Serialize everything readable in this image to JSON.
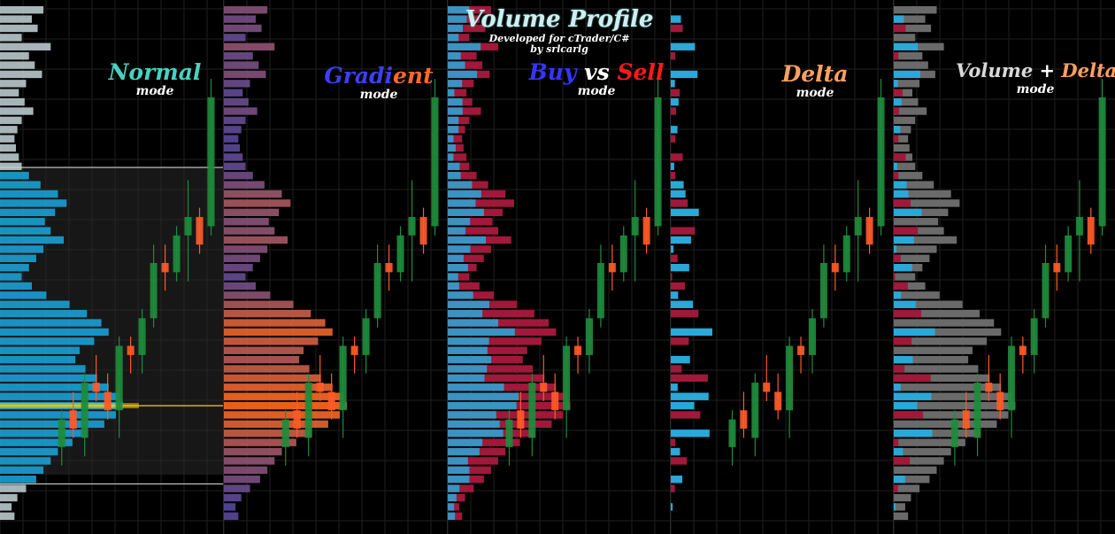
{
  "header": {
    "title": "Volume Profile",
    "subtitle": "Developed for cTrader/C#",
    "author": "by srlcarlg"
  },
  "panels": [
    {
      "id": "normal",
      "title_parts": [
        {
          "text": "Normal",
          "color": "#48d1c0"
        }
      ],
      "mode_label": "mode",
      "variant": "normal"
    },
    {
      "id": "gradient",
      "title_parts": [
        {
          "text": "Gradi",
          "color": "#3f3ff0"
        },
        {
          "text": "ent",
          "color": "#ff6a28"
        }
      ],
      "mode_label": "mode",
      "variant": "gradient"
    },
    {
      "id": "buysell",
      "title_parts": [
        {
          "text": "Buy",
          "color": "#3535ff"
        },
        {
          "text": " vs ",
          "color": "#ffffff"
        },
        {
          "text": "Sell",
          "color": "#ff1a1a"
        }
      ],
      "mode_label": "mode",
      "variant": "buysell"
    },
    {
      "id": "delta",
      "title_parts": [
        {
          "text": "Delta",
          "color": "#ffa060"
        }
      ],
      "mode_label": "mode",
      "variant": "delta"
    },
    {
      "id": "voldelta",
      "title_parts": [
        {
          "text": "Volume",
          "color": "#d8d8d8"
        },
        {
          "text": " + ",
          "color": "#ffffff"
        },
        {
          "text": "Delta",
          "color": "#ffa060"
        }
      ],
      "mode_label": "mode",
      "variant": "voldelta"
    }
  ],
  "colors": {
    "background": "#000000",
    "grid": "#1f1f1f",
    "bull_candle": "#1e8c3c",
    "bear_candle": "#ff5a28",
    "doji_candle": "#ff6a28",
    "volume_normal": "#1aa0d4",
    "volume_outside_va": "#b9c9cc",
    "value_area_fill": "#2a2a2a",
    "value_area_line": "#d0d0d0",
    "poc_line": "#ffd000",
    "buy": "#2aa8d8",
    "sell": "#a0183a",
    "delta_positive": "#2aa8d8",
    "delta_negative": "#a0183a",
    "total_volume": "#6a6a6a",
    "gradient_low": "#4444aa",
    "gradient_high": "#ff6a20"
  },
  "chart_data": {
    "type": "bar",
    "orientation": "horizontal",
    "price_levels_count": 56,
    "volume": [
      60,
      44,
      52,
      30,
      70,
      40,
      48,
      58,
      36,
      26,
      34,
      46,
      30,
      24,
      20,
      22,
      26,
      30,
      40,
      56,
      80,
      92,
      76,
      62,
      70,
      88,
      60,
      50,
      40,
      30,
      44,
      64,
      96,
      120,
      140,
      150,
      130,
      110,
      104,
      118,
      134,
      150,
      164,
      170,
      160,
      144,
      120,
      100,
      80,
      70,
      60,
      50,
      36,
      24,
      16,
      20
    ],
    "buy_share": [
      0.5,
      0.6,
      0.4,
      0.5,
      0.65,
      0.45,
      0.5,
      0.7,
      0.55,
      0.35,
      0.6,
      0.45,
      0.5,
      0.62,
      0.4,
      0.5,
      0.3,
      0.55,
      0.45,
      0.6,
      0.58,
      0.42,
      0.66,
      0.5,
      0.35,
      0.6,
      0.52,
      0.44,
      0.7,
      0.48,
      0.36,
      0.55,
      0.6,
      0.4,
      0.5,
      0.62,
      0.44,
      0.5,
      0.58,
      0.46,
      0.38,
      0.52,
      0.6,
      0.56,
      0.42,
      0.5,
      0.64,
      0.48,
      0.55,
      0.4,
      0.5,
      0.6,
      0.45,
      0.5,
      0.55,
      0.5
    ],
    "poc_level": 43,
    "value_area": [
      18,
      51
    ],
    "candles": [
      {
        "o": 48,
        "h": 50,
        "l": 44,
        "c": 45
      },
      {
        "o": 44,
        "h": 47,
        "l": 42,
        "c": 46
      },
      {
        "o": 47,
        "h": 49,
        "l": 40,
        "c": 41
      },
      {
        "o": 41,
        "h": 43,
        "l": 38,
        "c": 42
      },
      {
        "o": 42,
        "h": 45,
        "l": 40,
        "c": 44
      },
      {
        "o": 44,
        "h": 47,
        "l": 36,
        "c": 37
      },
      {
        "o": 37,
        "h": 40,
        "l": 36,
        "c": 38
      },
      {
        "o": 38,
        "h": 40,
        "l": 33,
        "c": 34
      },
      {
        "o": 34,
        "h": 35,
        "l": 26,
        "c": 28
      },
      {
        "o": 28,
        "h": 31,
        "l": 26,
        "c": 29
      },
      {
        "o": 29,
        "h": 30,
        "l": 24,
        "c": 25
      },
      {
        "o": 25,
        "h": 30,
        "l": 19,
        "c": 23
      },
      {
        "o": 23,
        "h": 27,
        "l": 22,
        "c": 26
      },
      {
        "o": 24,
        "h": 25,
        "l": 8,
        "c": 10
      }
    ]
  }
}
